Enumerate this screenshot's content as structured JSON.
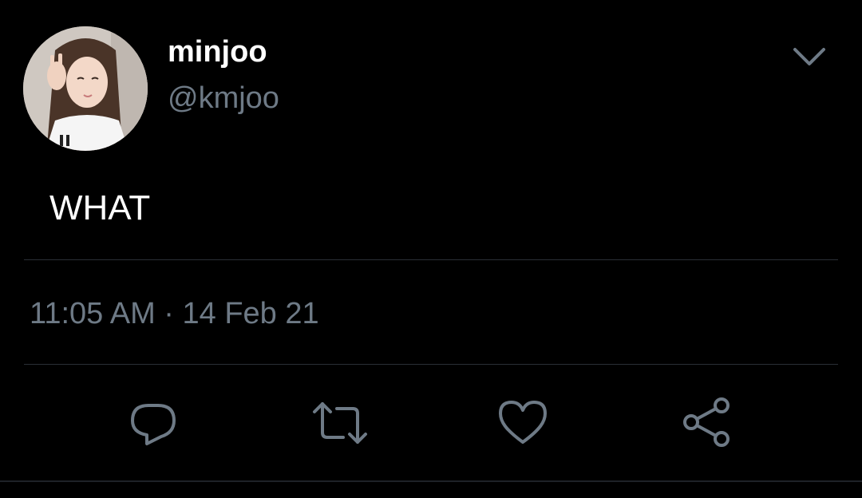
{
  "user": {
    "display_name": "minjoo",
    "handle": "@kmjoo",
    "avatar": "profile-photo"
  },
  "tweet": {
    "text": "WHAT",
    "time": "11:05 AM",
    "separator": "·",
    "date": "14 Feb 21"
  },
  "actions": {
    "reply": "reply-icon",
    "retweet": "retweet-icon",
    "like": "heart-icon",
    "share": "share-icon",
    "menu": "chevron-down-icon"
  },
  "colors": {
    "background": "#000000",
    "primary_text": "#ffffff",
    "secondary_text": "#6e7a86",
    "divider": "#2a2f36"
  }
}
